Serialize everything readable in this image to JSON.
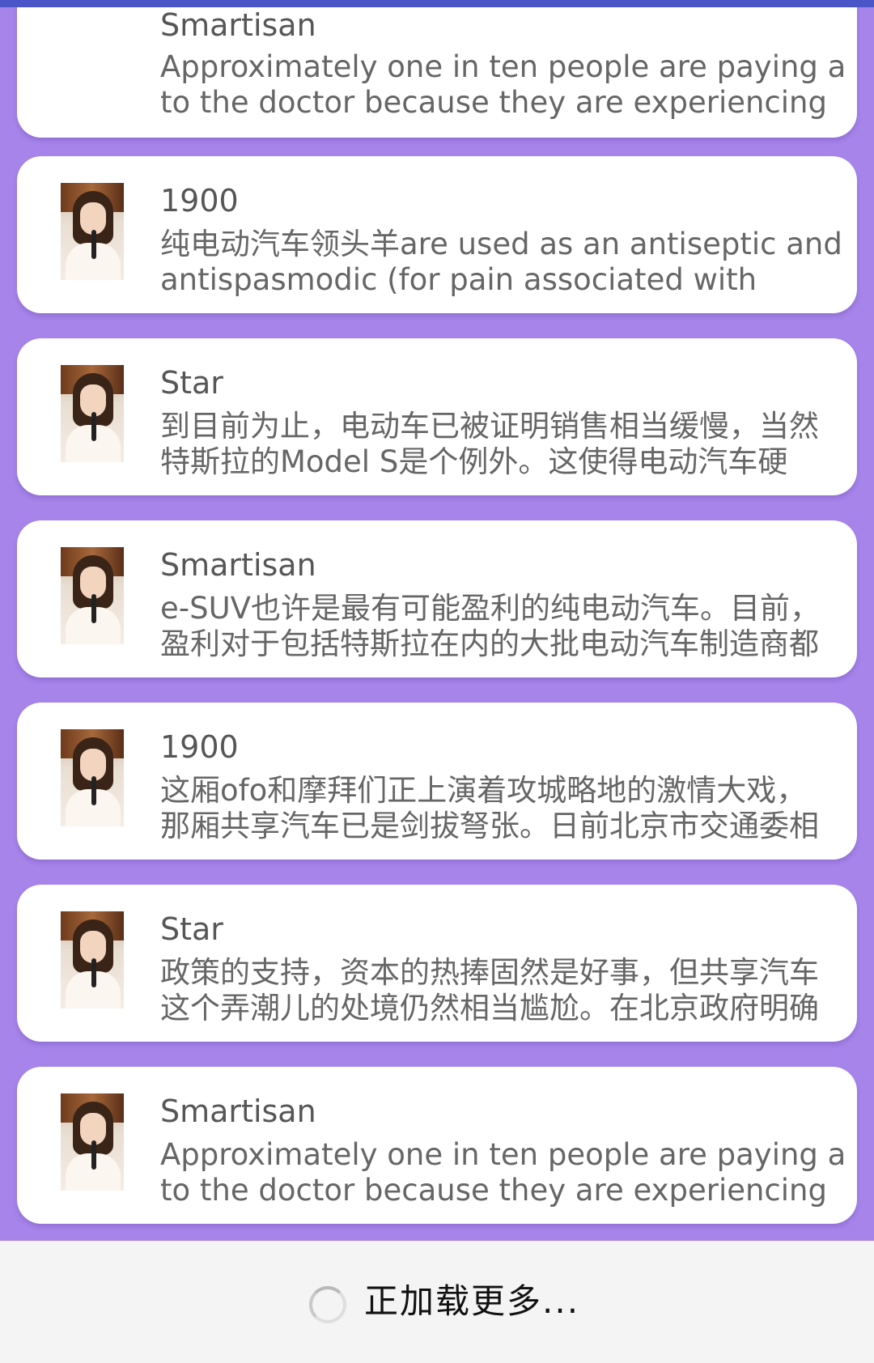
{
  "items": [
    {
      "title": "Smartisan",
      "line1": "Approximately one in ten people are paying a visit",
      "line2": "to the doctor because they are experiencing",
      "avatar": "singer-photo"
    },
    {
      "title": "1900",
      "line1": "纯电动汽车领头羊are used as an antiseptic and",
      "line2": "antispasmodic (for pain associated with",
      "avatar": "singer-photo"
    },
    {
      "title": "Star",
      "line1": "到目前为止，电动车已被证明销售相当缓慢，当然",
      "line2": "特斯拉的Model S是个例外。这使得电动汽车硬",
      "avatar": "singer-photo"
    },
    {
      "title": "Smartisan",
      "line1": "e-SUV也许是最有可能盈利的纯电动汽车。目前，",
      "line2": "盈利对于包括特斯拉在内的大批电动汽车制造商都",
      "avatar": "singer-photo"
    },
    {
      "title": "1900",
      "line1": "这厢ofo和摩拜们正上演着攻城略地的激情大戏，",
      "line2": "那厢共享汽车已是剑拔弩张。日前北京市交通委相",
      "avatar": "singer-photo"
    },
    {
      "title": "Star",
      "line1": "政策的支持，资本的热捧固然是好事，但共享汽车",
      "line2": "这个弄潮儿的处境仍然相当尴尬。在北京政府明确",
      "avatar": "singer-photo"
    },
    {
      "title": "Smartisan",
      "line1": "Approximately one in ten people are paying a visit",
      "line2": "to the doctor because they are experiencing",
      "avatar": "singer-photo"
    }
  ],
  "footer": {
    "loading_text": "正加载更多...",
    "spinner_icon": "loading-spinner-icon"
  },
  "colors": {
    "status_bar": "#4a56c7",
    "list_background": "#a684ea",
    "card_background": "#ffffff",
    "title_text": "#565656",
    "body_text": "#666666"
  }
}
